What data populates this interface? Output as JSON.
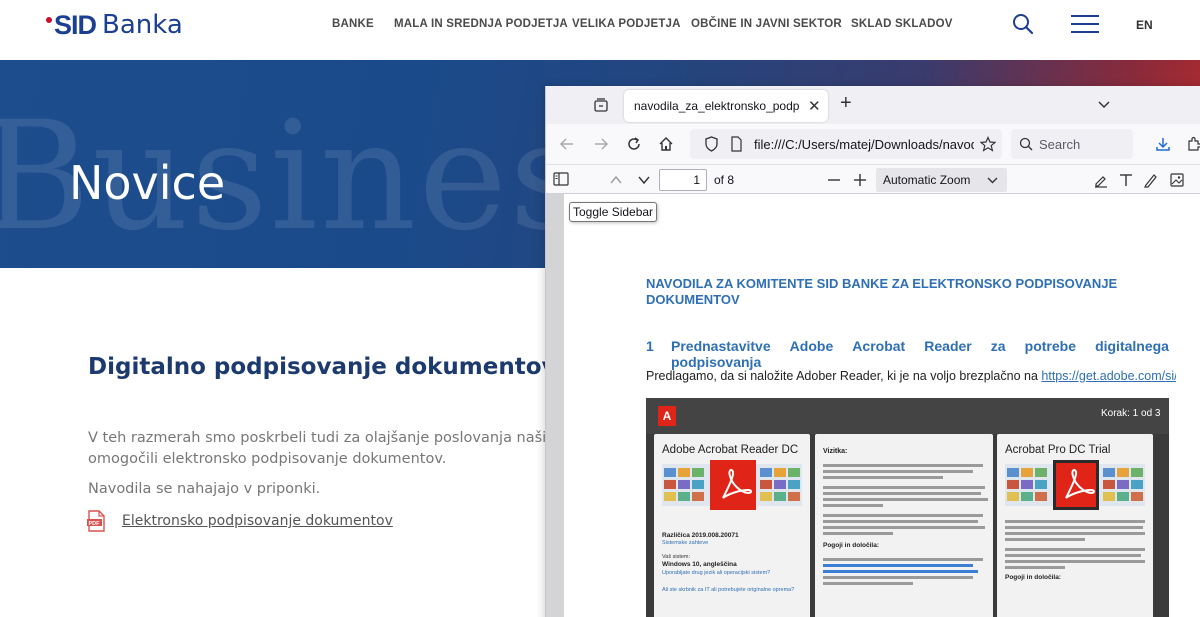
{
  "site": {
    "logo_mark": "SID",
    "logo_text": "Banka",
    "nav": [
      "BANKE",
      "MALA IN SREDNJA PODJETJA",
      "VELIKA PODJETJA",
      "OBČINE IN JAVNI SEKTOR",
      "SKLAD SKLADOV"
    ],
    "lang": "EN",
    "brand_blue": "#1c3f94",
    "brand_red": "#c8102e"
  },
  "hero": {
    "title": "Novice",
    "watermark": "Busines"
  },
  "article": {
    "title": "Digitalno podpisovanje dokumentov",
    "p1_line1": "V teh razmerah smo poskrbeli tudi za olajšanje poslovanja naših strank",
    "p1_line2": "omogočili elektronsko podpisovanje dokumentov.",
    "p2": "Navodila se nahajajo v priponki.",
    "attachment_label": "Elektronsko podpisovanje dokumentov",
    "attachment_icon": "pdf-file-icon"
  },
  "browser": {
    "tab_title": "navodila_za_elektronsko_podpisovanje",
    "url": "file:///C:/Users/matej/Downloads/navodila_za_elektronsko_podpisovanje",
    "search_placeholder": "Search",
    "page_number": "1",
    "page_of": "of 8",
    "zoom": "Automatic Zoom",
    "tooltip": "Toggle Sidebar"
  },
  "pdf": {
    "title": "NAVODILA ZA KOMITENTE SID BANKE ZA ELEKTRONSKO PODPISOVANJE DOKUMENTOV",
    "section_number": "1",
    "section_words": [
      "Prednastavitve",
      "Adobe",
      "Acrobat",
      "Reader",
      "za",
      "potrebe",
      "digitalnega"
    ],
    "section_line2": "podpisovanja",
    "para_text": "Predlagamo, da si naložite Adober Reader, ki je na voljo brezplačno na ",
    "para_link": "https://get.adobe.com/si/reader/",
    "shot": {
      "step": "Korak: 1 od 3",
      "card1_title": "Adobe Acrobat Reader DC",
      "card2_title": "Vizitka:",
      "card2_bold": "Pogoji in določila:",
      "card3_title": "Acrobat Pro DC Trial",
      "card3_bold": "Pogoji in določila:",
      "card1_version": "Različica 2019.008.20071",
      "card1_sys_label": "Vaš sistem:",
      "card1_sys": "Windows 10, angleščina",
      "card1_link1": "Sistemske zahteve",
      "card1_link2": "Uporabljate drug jezik ali operacijski sistem?",
      "card1_link3": "Ali ste skrbnik za IT ali potrebujete originalne oprema?"
    }
  }
}
